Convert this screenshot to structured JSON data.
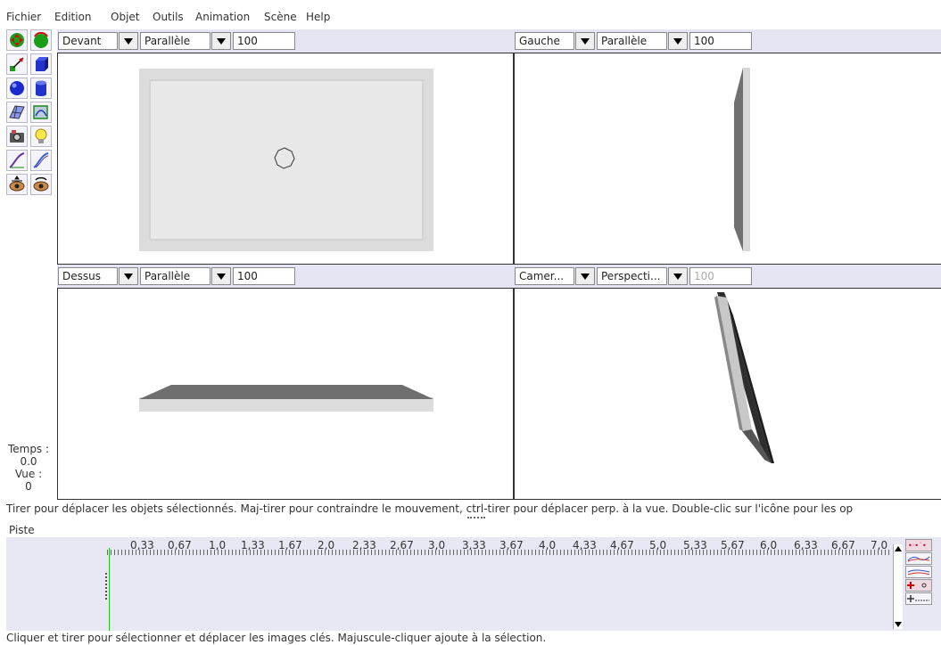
{
  "menu": [
    "Fichier",
    "Edition",
    "Objet",
    "Outils",
    "Animation",
    "Scène",
    "Help"
  ],
  "tools": [
    {
      "name": "move-tool-icon"
    },
    {
      "name": "rotate-tool-icon"
    },
    {
      "name": "scale-tool-icon"
    },
    {
      "name": "create-cube-icon"
    },
    {
      "name": "create-sphere-icon"
    },
    {
      "name": "create-cylinder-icon"
    },
    {
      "name": "create-polygon-icon"
    },
    {
      "name": "create-spline-icon"
    },
    {
      "name": "create-camera-icon"
    },
    {
      "name": "create-light-icon"
    },
    {
      "name": "create-curve-icon"
    },
    {
      "name": "create-tube-icon"
    },
    {
      "name": "move-view-icon"
    },
    {
      "name": "rotate-view-icon"
    }
  ],
  "info": {
    "time_label": "Temps :",
    "time_value": "0.0",
    "view_label": "Vue :",
    "view_value": "0"
  },
  "viewports": [
    {
      "id": "front",
      "view": "Devant",
      "projection": "Parallèle",
      "zoom": "100"
    },
    {
      "id": "left",
      "view": "Gauche",
      "projection": "Parallèle",
      "zoom": "100"
    },
    {
      "id": "top",
      "view": "Dessus",
      "projection": "Parallèle",
      "zoom": "100"
    },
    {
      "id": "camera",
      "view": "Camer...",
      "projection": "Perspecti...",
      "zoom": "100"
    }
  ],
  "status": "Tirer pour déplacer les objets sélectionnés.  Maj-tirer pour contraindre le mouvement, ctrl-tirer pour déplacer perp. à la vue.  Double-clic sur l'icône pour les op",
  "timeline": {
    "header": "Piste",
    "ticks": [
      "0,33",
      "0,67",
      "1,0",
      "1,33",
      "1,67",
      "2,0",
      "2,33",
      "2,67",
      "3,0",
      "3,33",
      "3,67",
      "4,0",
      "4,33",
      "4,67",
      "5,0",
      "5,33",
      "5,67",
      "6,0",
      "6,33",
      "6,67",
      "7,0"
    ]
  },
  "bottom_status": "Cliquer et tirer pour sélectionner et déplacer les images clés.  Majuscule-cliquer ajoute à la sélection."
}
